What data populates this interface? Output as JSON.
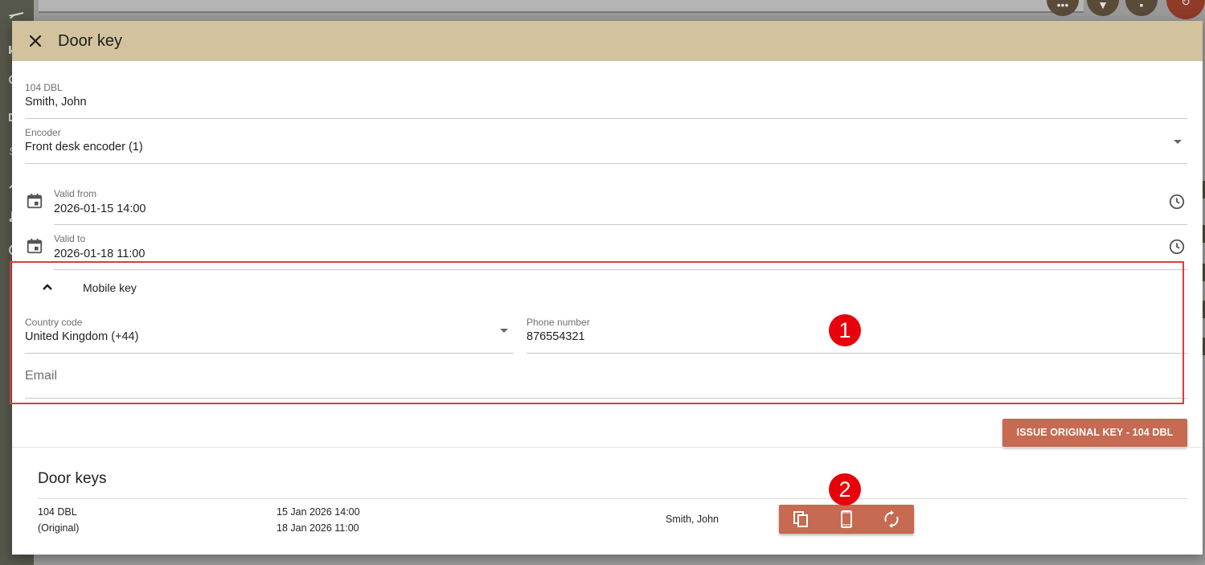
{
  "dialog": {
    "title": "Door key",
    "close_icon": "close-icon"
  },
  "form": {
    "room": {
      "label": "104 DBL",
      "value": "Smith, John"
    },
    "encoder": {
      "label": "Encoder",
      "value": "Front desk encoder (1)"
    },
    "valid_from": {
      "label": "Valid from",
      "value": "2026-01-15 14:00"
    },
    "valid_to": {
      "label": "Valid to",
      "value": "2026-01-18 11:00"
    }
  },
  "mobile_key": {
    "title": "Mobile key",
    "country_code": {
      "label": "Country code",
      "value": "United Kingdom (+44)"
    },
    "phone_number": {
      "label": "Phone number",
      "value": "876554321"
    },
    "email": {
      "placeholder": "Email"
    }
  },
  "annotations": {
    "marker_1": "1",
    "marker_2": "2",
    "highlight_color": "#e0393e",
    "marker_color": "#e8000b"
  },
  "issue_button": {
    "label": "ISSUE ORIGINAL KEY - 104 DBL"
  },
  "door_keys": {
    "title": "Door keys",
    "rows": [
      {
        "room": "104 DBL",
        "kind": "(Original)",
        "from": "15 Jan 2026 14:00",
        "to": "18 Jan 2026 11:00",
        "guest": "Smith, John",
        "actions": [
          "copy-icon",
          "mobile-phone-icon",
          "sync-icon"
        ]
      }
    ]
  },
  "colors": {
    "header": "#d2c29e",
    "button": "#c66a52"
  }
}
